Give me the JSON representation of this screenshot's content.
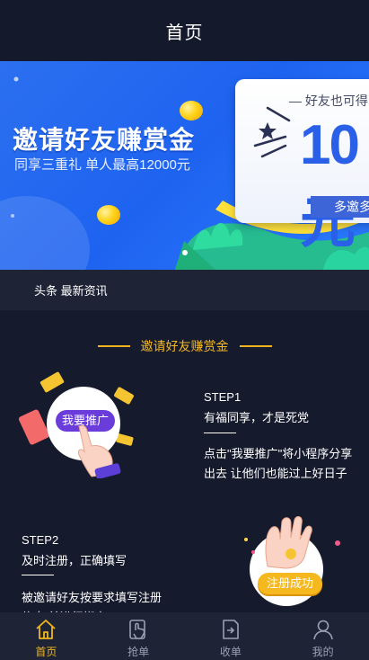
{
  "header": {
    "title": "首页"
  },
  "banner": {
    "title": "邀请好友赚赏金",
    "subtitle": "同享三重礼 单人最高12000元",
    "card_caption": "— 好友也可得",
    "card_big": "10元",
    "card_button": "多邀多"
  },
  "news": {
    "label": "头条 最新资讯"
  },
  "section": {
    "title": "邀请好友赚赏金"
  },
  "step1": {
    "title": "STEP1",
    "subtitle": "有福同享，才是死党",
    "text": "点击\"我要推广\"将小程序分享出去 让他们也能过上好日子",
    "button": "我要推广"
  },
  "step2": {
    "title": "STEP2",
    "subtitle": "及时注册，正确填写",
    "text": "被邀请好友按要求填写注册信息 并进行绑定",
    "badge": "注册成功"
  },
  "tabs": [
    {
      "label": "首页",
      "icon": "home-icon",
      "active": true
    },
    {
      "label": "抢单",
      "icon": "grab-order-icon",
      "active": false
    },
    {
      "label": "收单",
      "icon": "receive-order-icon",
      "active": false
    },
    {
      "label": "我的",
      "icon": "user-icon",
      "active": false
    }
  ],
  "colors": {
    "background": "#151a2d",
    "accent": "#f0b51e",
    "banner_blue": "#1e63f0",
    "purple": "#6a3ddb",
    "yellow_pill": "#f6b81f"
  }
}
